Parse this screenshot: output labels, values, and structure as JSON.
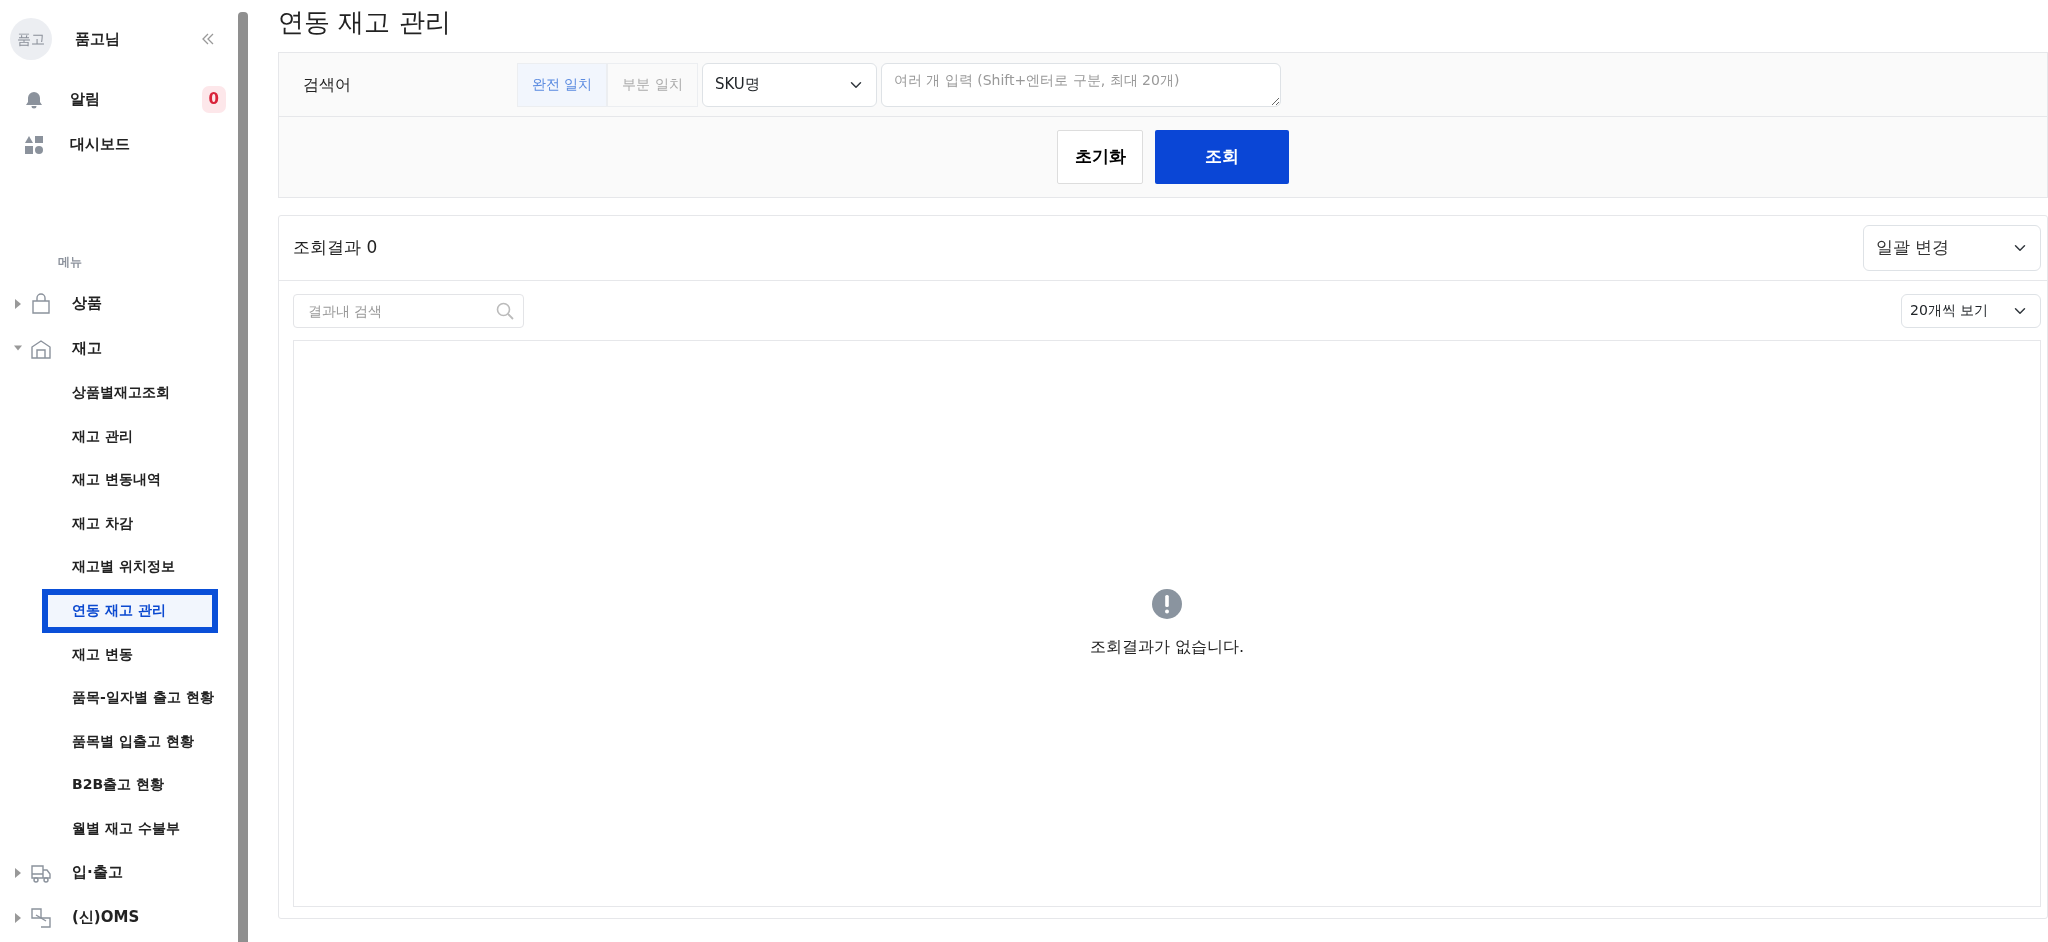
{
  "sidebar": {
    "avatar": "품고",
    "user_name": "품고님",
    "items": [
      {
        "label": "알림",
        "badge": "0"
      },
      {
        "label": "대시보드"
      }
    ],
    "menu_heading": "메뉴",
    "menu": [
      {
        "label": "상품",
        "expanded": false
      },
      {
        "label": "재고",
        "expanded": true,
        "children": [
          {
            "label": "상품별재고조회",
            "selected": false
          },
          {
            "label": "재고 관리",
            "selected": false
          },
          {
            "label": "재고 변동내역",
            "selected": false
          },
          {
            "label": "재고 차감",
            "selected": false
          },
          {
            "label": "재고별 위치정보",
            "selected": false
          },
          {
            "label": "연동 재고 관리",
            "selected": true
          },
          {
            "label": "재고 변동",
            "selected": false
          },
          {
            "label": "품목-일자별 출고 현황",
            "selected": false
          },
          {
            "label": "품목별 입출고 현황",
            "selected": false
          },
          {
            "label": "B2B출고 현황",
            "selected": false
          },
          {
            "label": "월별 재고 수불부",
            "selected": false
          }
        ]
      },
      {
        "label": "입·출고",
        "expanded": false
      },
      {
        "label": "(신)OMS",
        "expanded": false
      }
    ]
  },
  "page_title": "연동 재고 관리",
  "search": {
    "label": "검색어",
    "match_modes": [
      {
        "label": "완전 일치",
        "selected": true
      },
      {
        "label": "부분 일치",
        "selected": false
      }
    ],
    "field_select": "SKU명",
    "keyword": {
      "placeholder": "여러 개 입력 (Shift+엔터로 구분, 최대 20개)"
    },
    "buttons": [
      {
        "label": "초기화",
        "kind": "secondary"
      },
      {
        "label": "조회",
        "kind": "primary"
      }
    ]
  },
  "results": {
    "count_label": "조회결과 0",
    "bulk_select": "일괄 변경",
    "filter": {
      "placeholder": "결과내 검색"
    },
    "page_size": "20개씩 보기",
    "empty_message": "조회결과가 없습니다."
  }
}
